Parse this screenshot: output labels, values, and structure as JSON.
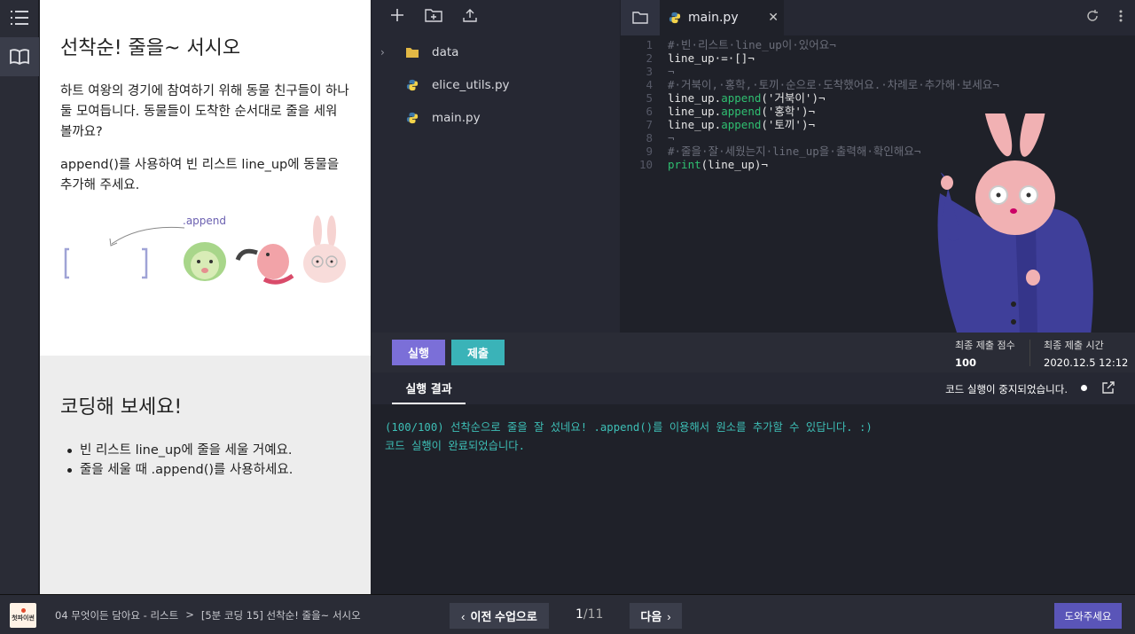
{
  "lesson": {
    "title": "선착순! 줄을~ 서시오",
    "paragraph1": "하트 여왕의 경기에 참여하기 위해 동물 친구들이 하나둘 모여듭니다. 동물들이 도착한 순서대로 줄을 세워 볼까요?",
    "paragraph2": "append()를 사용하여 빈 리스트 line_up에 동물을 추가해 주세요.",
    "illustration_label": ".append",
    "practice_title": "코딩해 보세요!",
    "bullets": [
      "빈 리스트 line_up에 줄을 세울 거예요.",
      "줄을 세울 때 .append()를 사용하세요."
    ]
  },
  "explorer": {
    "files": [
      {
        "name": "data",
        "icon": "folder-icon"
      },
      {
        "name": "elice_utils.py",
        "icon": "python-icon"
      },
      {
        "name": "main.py",
        "icon": "python-icon"
      }
    ]
  },
  "editor": {
    "tab_name": "main.py",
    "lines": [
      {
        "n": "1",
        "text": "#·빈·리스트·line_up이·있어요¬"
      },
      {
        "n": "2",
        "text": "line_up·=·[]¬"
      },
      {
        "n": "3",
        "text": "¬"
      },
      {
        "n": "4",
        "text": "#·거북이,·홍학,·토끼·순으로·도착했어요.·차례로·추가해·보세요¬"
      },
      {
        "n": "5",
        "text": "line_up.append('거북이')¬"
      },
      {
        "n": "6",
        "text": "line_up.append('홍학')¬"
      },
      {
        "n": "7",
        "text": "line_up.append('토끼')¬"
      },
      {
        "n": "8",
        "text": "¬"
      },
      {
        "n": "9",
        "text": "#·줄을·잘·세웠는지·line_up을·출력해·확인해요¬"
      },
      {
        "n": "10",
        "text": "print(line_up)¬"
      }
    ]
  },
  "actions": {
    "run": "실행",
    "submit": "제출",
    "score_label": "최종 제출 점수",
    "score_value": "100",
    "time_label": "최종 제출 시간",
    "time_value": "2020.12.5 12:12"
  },
  "output": {
    "tab": "실행 결과",
    "status": "코드 실행이 중지되었습니다.",
    "lines": [
      "(100/100) 선착순으로 줄을 잘 섰네요! .append()를 이용해서 원소를 추가할 수 있답니다. :)",
      "코드 실행이 완료되었습니다."
    ]
  },
  "bottom": {
    "logo_text": "첫파이썬",
    "crumb1": "04 무엇이든 담아요 - 리스트",
    "crumb_sep": ">",
    "crumb2": "[5분 코딩 15] 선착순! 줄을~ 서시오",
    "prev": "이전 수업으로",
    "page_current": "1",
    "page_total": "/11",
    "next": "다음",
    "help": "도와주세요"
  },
  "colors": {
    "accent_run": "#7b6fd8",
    "accent_submit": "#3ab3b8",
    "output_text": "#3dbfb6",
    "code_fn": "#2fbf71"
  }
}
